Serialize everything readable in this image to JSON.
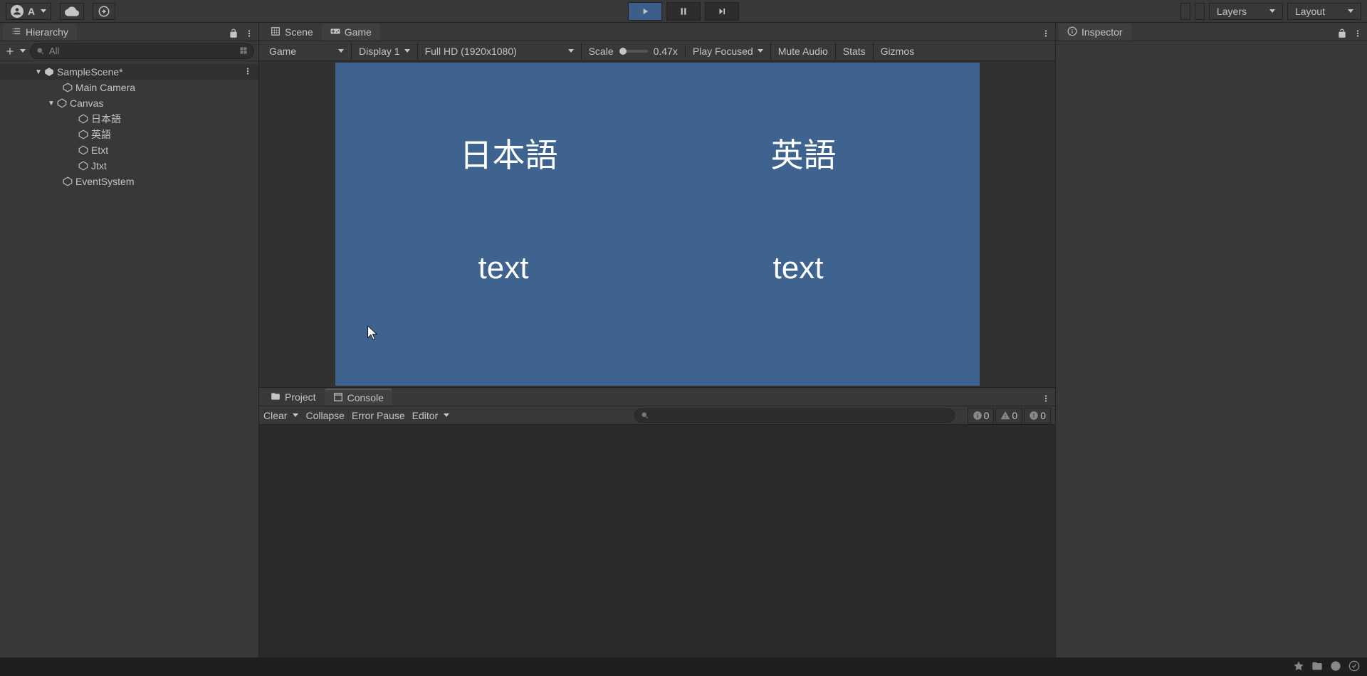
{
  "topbar": {
    "account_label": "A",
    "layers_label": "Layers",
    "layout_label": "Layout"
  },
  "hierarchy": {
    "tab_label": "Hierarchy",
    "search_placeholder": "All",
    "tree": {
      "root": "SampleScene*",
      "items": [
        "Main Camera",
        "Canvas",
        "日本語",
        "英語",
        "Etxt",
        "Jtxt",
        "EventSystem"
      ]
    }
  },
  "scene_tabs": {
    "scene": "Scene",
    "game": "Game"
  },
  "game_toolbar": {
    "view_dd": "Game",
    "display_dd": "Display 1",
    "resolution_dd": "Full HD (1920x1080)",
    "scale_label": "Scale",
    "scale_value": "0.47x",
    "focus_dd": "Play Focused",
    "mute_label": "Mute Audio",
    "stats_label": "Stats",
    "gizmos_label": "Gizmos"
  },
  "game_canvas": {
    "jp_btn": "日本語",
    "en_btn": "英語",
    "jtxt": "text",
    "etxt": "text"
  },
  "project_console": {
    "project_tab": "Project",
    "console_tab": "Console",
    "clear_label": "Clear",
    "collapse_label": "Collapse",
    "error_pause_label": "Error Pause",
    "editor_label": "Editor",
    "info_count": "0",
    "warn_count": "0",
    "err_count": "0"
  },
  "inspector": {
    "tab_label": "Inspector"
  }
}
